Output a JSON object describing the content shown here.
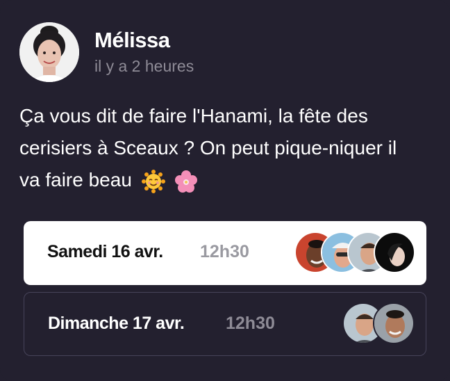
{
  "post": {
    "author": "Mélissa",
    "time": "il y a 2 heures",
    "message": "Ça vous dit de faire l'Hanami, la fête des cerisiers à Sceaux ? On peut pique-niquer il va faire beau",
    "emojis": [
      "smiling-sun-icon",
      "cherry-blossom-icon"
    ]
  },
  "slots": [
    {
      "day": "Samedi 16 avr.",
      "time": "12h30",
      "participants": 4
    },
    {
      "day": "Dimanche 17 avr.",
      "time": "12h30",
      "participants": 2
    }
  ],
  "colors": {
    "background": "#23202f",
    "selected_slot": "#ffffff",
    "muted_text": "#8e8b96"
  }
}
